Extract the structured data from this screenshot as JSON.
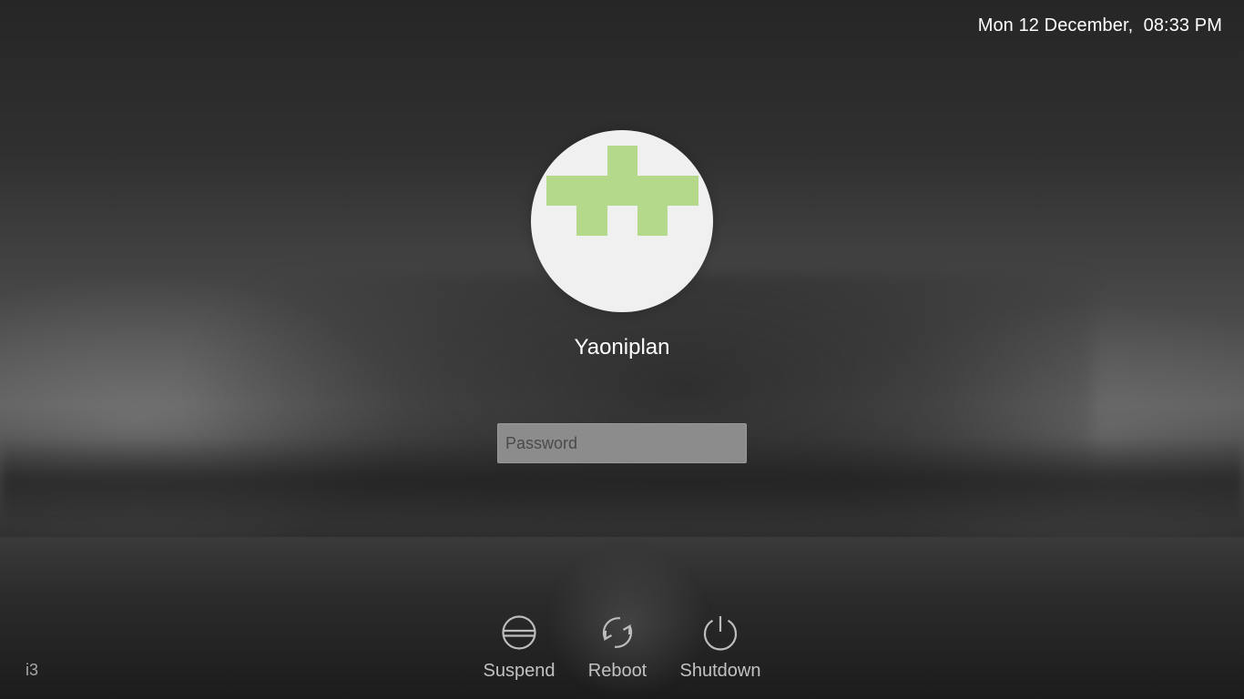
{
  "header": {
    "datetime": "Mon 12 December,  08:33 PM"
  },
  "user": {
    "name": "Yaoniplan",
    "avatar_icon": "green-puzzle-logo-icon",
    "avatar_bg": "#f0f0f0",
    "logo_color": "#b5d98a"
  },
  "login": {
    "password_placeholder": "Password",
    "password_value": ""
  },
  "power": {
    "suspend_label": "Suspend",
    "suspend_icon": "suspend-icon",
    "reboot_label": "Reboot",
    "reboot_icon": "reboot-icon",
    "shutdown_label": "Shutdown",
    "shutdown_icon": "power-icon"
  },
  "session": {
    "name": "i3"
  }
}
